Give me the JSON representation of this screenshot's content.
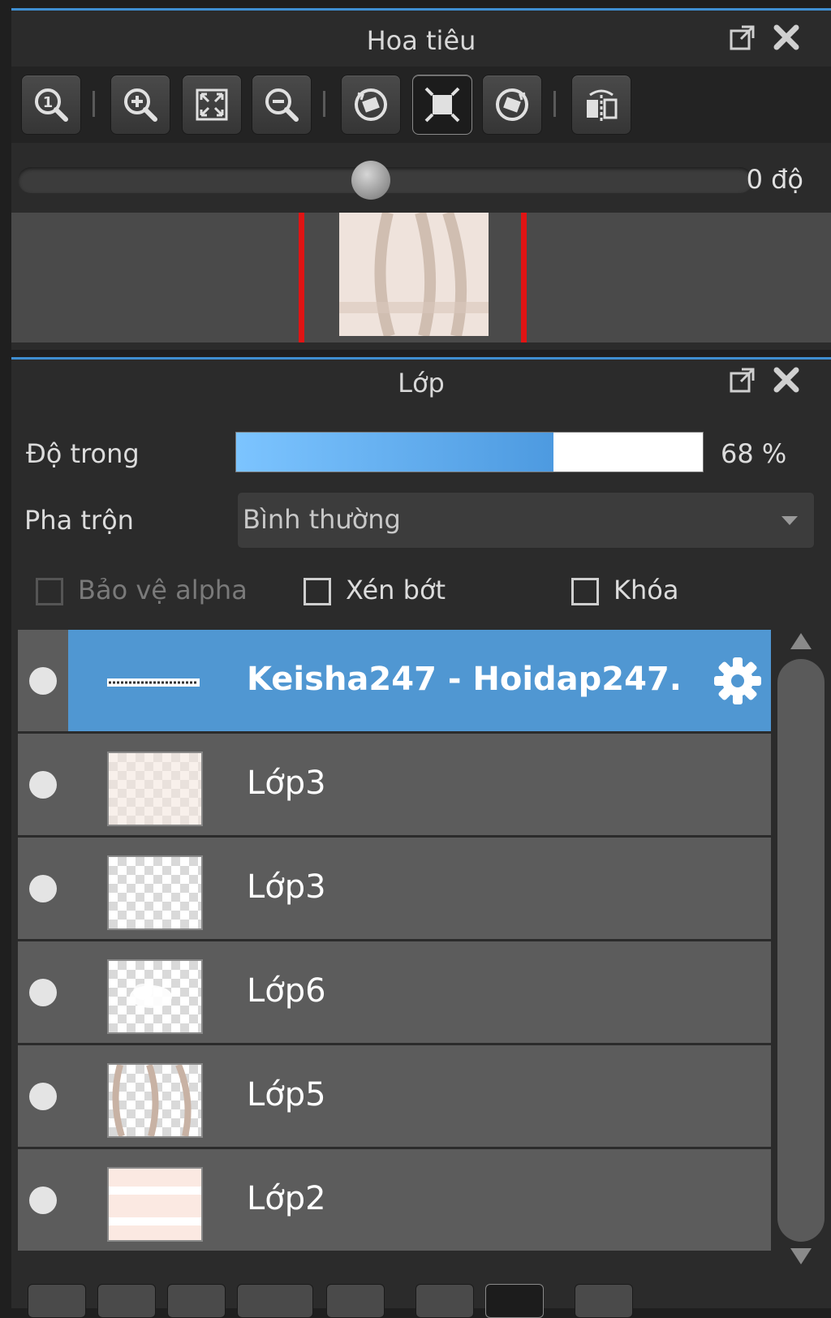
{
  "navigator": {
    "title": "Hoa tiêu",
    "rotation_label": "0 độ",
    "rotation_fraction": 0.48,
    "toolbar_icons": [
      "zoom-actual-icon",
      "zoom-in-icon",
      "fit-screen-icon",
      "zoom-out-icon",
      "rotate-left-icon",
      "fit-window-icon",
      "rotate-right-icon",
      "flip-horizontal-icon"
    ]
  },
  "layers": {
    "title": "Lớp",
    "opacity_label": "Độ trong",
    "opacity_value": "68 %",
    "opacity_fraction": 0.68,
    "blend_label": "Pha trộn",
    "blend_value": "Bình thường",
    "protect_alpha_label": "Bảo vệ alpha",
    "clip_label": "Xén bớt",
    "lock_label": "Khóa",
    "items": [
      {
        "name": "Keisha247 - Hoidap247.",
        "selected": true
      },
      {
        "name": "Lớp3",
        "selected": false
      },
      {
        "name": "Lớp3",
        "selected": false
      },
      {
        "name": "Lớp6",
        "selected": false
      },
      {
        "name": "Lớp5",
        "selected": false
      },
      {
        "name": "Lớp2",
        "selected": false
      }
    ]
  },
  "colors": {
    "accent": "#3f8fd2",
    "selected_row": "#5097d2",
    "opacity_fill": "#4d9ae0",
    "preview_frame": "#e01414"
  }
}
